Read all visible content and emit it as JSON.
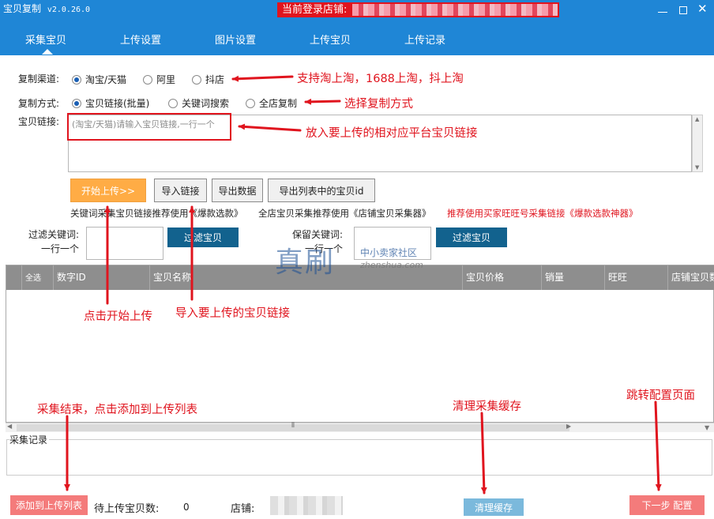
{
  "window": {
    "title": "宝贝复制",
    "version": "v2.0.26.0",
    "login_label": "当前登录店铺:",
    "controls": [
      "minimize",
      "maximize",
      "close"
    ]
  },
  "nav": {
    "tabs": [
      "采集宝贝",
      "上传设置",
      "图片设置",
      "上传宝贝",
      "上传记录"
    ],
    "active_index": 0
  },
  "form": {
    "channel_label": "复制渠道:",
    "channels": [
      {
        "label": "淘宝/天猫",
        "selected": true
      },
      {
        "label": "阿里",
        "selected": false
      },
      {
        "label": "抖店",
        "selected": false
      }
    ],
    "mode_label": "复制方式:",
    "modes": [
      {
        "label": "宝贝链接(批量)",
        "selected": true
      },
      {
        "label": "关键词搜索",
        "selected": false
      },
      {
        "label": "全店复制",
        "selected": false
      }
    ],
    "link_label": "宝贝链接:",
    "link_placeholder": "(淘宝/天猫)请输入宝贝链接,一行一个"
  },
  "actions": {
    "start": "开始上传>>",
    "import_links": "导入链接",
    "export_data": "导出数据",
    "export_ids": "导出列表中的宝贝id"
  },
  "recommend": {
    "keyword": "关键词采集宝贝链接推荐使用《爆款选款》",
    "shop": "全店宝贝采集推荐使用《店铺宝贝采集器》",
    "buyer": "推荐使用买家旺旺号采集链接《爆款选款神器》"
  },
  "filters": {
    "filter_keyword_label_1": "过滤关键词:",
    "filter_keyword_label_2": "一行一个",
    "filter_button": "过滤宝贝",
    "keep_keyword_label_1": "保留关键词:",
    "keep_keyword_label_2": "一行一个",
    "keep_button": "过滤宝贝"
  },
  "table": {
    "columns": [
      "全选",
      "数字ID",
      "宝贝名称",
      "宝贝价格",
      "销量",
      "旺旺",
      "店铺宝贝数"
    ]
  },
  "log": {
    "label": "采集记录"
  },
  "footer": {
    "add_button": "添加到上传列表",
    "pending_label": "待上传宝贝数:",
    "pending_count": "0",
    "shop_label": "店铺:",
    "clean_button": "清理缓存",
    "next_button": "下一步 配置"
  },
  "annotations": {
    "channels_note": "支持淘上淘，1688上淘，抖上淘",
    "mode_note": "选择复制方式",
    "link_note": "放入要上传的相对应平台宝贝链接",
    "start_note": "点击开始上传",
    "import_note": "导入要上传的宝贝链接",
    "add_note": "采集结束，点击添加到上传列表",
    "clean_note": "清理采集缓存",
    "config_note": "跳转配置页面"
  },
  "watermark": {
    "big": "真刷",
    "small": "中小卖家社区",
    "url": "zhenshua.com"
  },
  "colors": {
    "titlebar": "#1f86d6",
    "accent_red": "#e0141e",
    "start_button": "#ffac45",
    "filter_button": "#12628e",
    "grid_header": "#8e8e8e",
    "pink_button": "#f47b7b",
    "clean_button": "#7bb9dc"
  }
}
